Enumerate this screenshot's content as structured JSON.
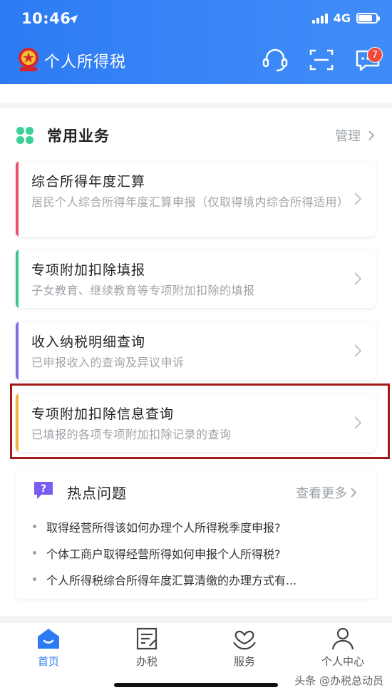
{
  "status_bar": {
    "time": "10:46",
    "network": "4G"
  },
  "app": {
    "title": "个人所得税",
    "message_badge": "7"
  },
  "common_services": {
    "title": "常用业务",
    "manage_label": "管理",
    "items": [
      {
        "title": "综合所得年度汇算",
        "desc": "居民个人综合所得年度汇算申报（仅取得境内综合所得适用）",
        "accent": "#e8506b"
      },
      {
        "title": "专项附加扣除填报",
        "desc": "子女教育、继续教育等专项附加扣除的填报",
        "accent": "#3cc58a"
      },
      {
        "title": "收入纳税明细查询",
        "desc": "已申报收入的查询及异议申诉",
        "accent": "#7c6ee8"
      },
      {
        "title": "专项附加扣除信息查询",
        "desc": "已填报的各项专项附加扣除记录的查询",
        "accent": "#f3b33d"
      }
    ]
  },
  "hot_questions": {
    "title": "热点问题",
    "more_label": "查看更多",
    "items": [
      "取得经营所得该如何办理个人所得税季度申报?",
      "个体工商户取得经营所得如何申报个人所得税?",
      "个人所得税综合所得年度汇算清缴的办理方式有..."
    ]
  },
  "tabbar": {
    "tabs": [
      {
        "label": "首页"
      },
      {
        "label": "办税"
      },
      {
        "label": "服务"
      },
      {
        "label": "个人中心"
      }
    ]
  },
  "watermark": "头条 @办税总动员",
  "colors": {
    "brand": "#2d7bf4",
    "highlight_border": "#a31a1a"
  }
}
